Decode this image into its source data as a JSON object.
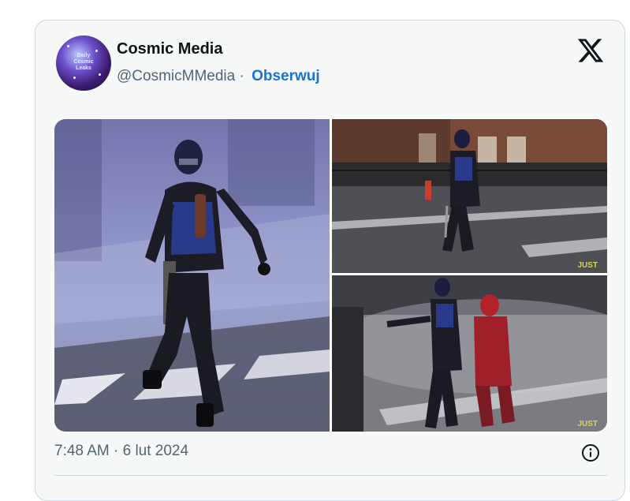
{
  "tweet": {
    "author_name": "Cosmic Media",
    "handle": "@CosmicMMedia",
    "separator": "·",
    "follow_label": "Obserwuj",
    "timestamp": "7:48 AM · 6 lut 2024",
    "avatar_text": [
      "Daily",
      "Cosmic",
      "Leaks"
    ],
    "platform_icon": "x-logo-icon",
    "info_icon": "info-icon"
  },
  "media": {
    "photos": [
      {
        "name": "photo-masked-figure-walking",
        "watermark": ""
      },
      {
        "name": "photo-masked-figure-street-night",
        "watermark": "JUST"
      },
      {
        "name": "photo-two-figures-fighting",
        "watermark": "JUST"
      }
    ]
  },
  "colors": {
    "accent": "#1d72d8",
    "text_primary": "#0f1419",
    "text_secondary": "#536471",
    "card_bg": "#f7f9f9",
    "border": "#cfd9de"
  }
}
